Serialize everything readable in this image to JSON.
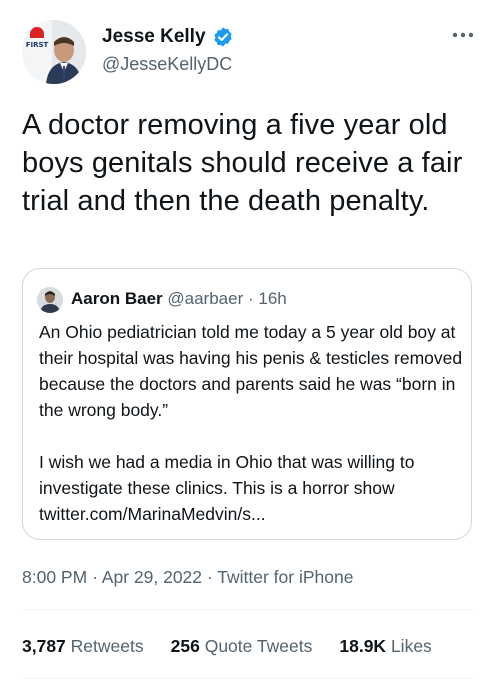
{
  "author": {
    "name": "Jesse Kelly",
    "handle": "@JesseKellyDC",
    "avatar_text": "FIRST"
  },
  "tweet": {
    "text": "A doctor removing a five year old boys genitals should receive a fair trial and then the death penalty."
  },
  "quote": {
    "name": "Aaron Baer",
    "handle": "@aarbaer",
    "separator": "·",
    "time": "16h",
    "paragraph1": "An Ohio pediatrician told me today a 5 year old boy at their hospital was having his penis & testicles removed because the doctors and parents said he was “born in the wrong body.”",
    "paragraph2": "I wish we had a media in Ohio that was willing to investigate these clinics. This is a horror show twitter.com/MarinaMedvin/s..."
  },
  "meta": {
    "time": "8:00 PM",
    "separator": "·",
    "date": "Apr 29, 2022",
    "source": "Twitter for iPhone"
  },
  "stats": {
    "retweets_count": "3,787",
    "retweets_label": "Retweets",
    "quotes_count": "256",
    "quotes_label": "Quote Tweets",
    "likes_count": "18.9K",
    "likes_label": "Likes"
  },
  "colors": {
    "verified": "#1d9bf0",
    "secondary_text": "#536471",
    "border": "#cfd9de"
  },
  "icons": {
    "verified": "verified-badge-icon",
    "more": "more-horizontal-icon"
  }
}
